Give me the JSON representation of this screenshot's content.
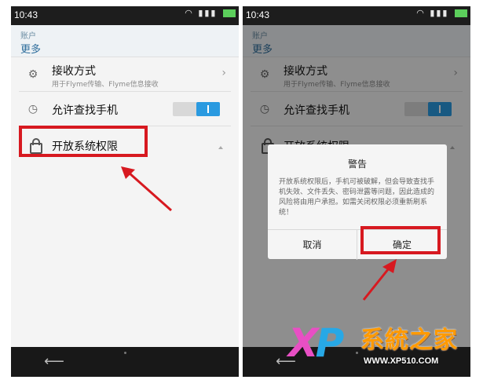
{
  "status": {
    "time": "10:43"
  },
  "header": {
    "breadcrumb": "账户",
    "title": "更多"
  },
  "settings": {
    "receive_mode": {
      "label": "接收方式",
      "sub": "用于Flyme传输、Flyme信息接收"
    },
    "find_phone": {
      "label": "允许查找手机",
      "toggle_on": true
    },
    "system_permission": {
      "label": "开放系统权限"
    }
  },
  "dialog": {
    "title": "警告",
    "message": "开放系统权限后，手机可被破解，但会导致查找手机失效、文件丢失、密码泄露等问题，因此造成的风险将由用户承担。如需关闭权限必须重新刷系统！",
    "cancel": "取消",
    "confirm": "确定"
  },
  "watermark": {
    "brand": "系統之家",
    "url": "WWW.XP510.COM",
    "x": "X",
    "p": "P"
  },
  "colors": {
    "annotation_red": "#d71920",
    "toggle_blue": "#2a9ae0",
    "title_blue": "#2f6e9c"
  }
}
